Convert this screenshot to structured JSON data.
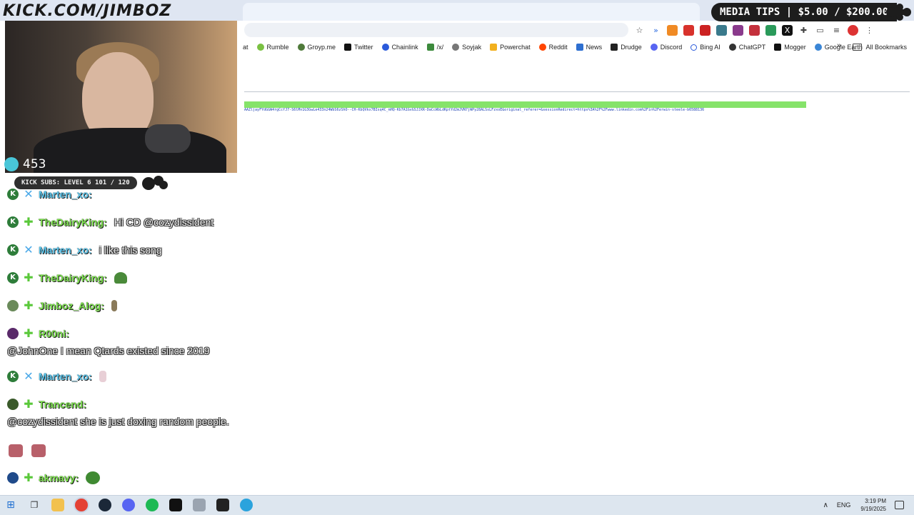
{
  "overlay": {
    "channel_url": "KICK.COM/JIMBOZ",
    "media_tips": "MEDIA TIPS | $5.00 / $200.00",
    "viewer_count": "453",
    "kick_subs": "KICK SUBS: LEVEL 6 101 / 120"
  },
  "browser": {
    "bookmarks": [
      "at",
      "Rumble",
      "Groyp.me",
      "Twitter",
      "Chainlink",
      "/x/",
      "Soyjak",
      "Powerchat",
      "Reddit",
      "News",
      "Drudge",
      "Discord",
      "Bing AI",
      "ChatGPT",
      "Mogger",
      "Google Earth"
    ],
    "all_bookmarks": "All Bookmarks",
    "page_url_text": "AAZljayFYdGGW4rgCcfJ7-S6lMn1G3GwLe433n24WbS6zShO--CH-KbQVkx7BIsq4C_mHQ-Kb7A1GvGSJJXR-DaCcWbLdKptYd2mJVN7jWPy28ALSsLFzxoE&original_referer=&sessionRedirect=https%3A%2F%2Fwww.linkedin.com%2Fin%2Ferwin-steele-b6588136"
  },
  "chat": {
    "messages": [
      {
        "user": "Marten_xo:",
        "text": ""
      },
      {
        "user": "TheDairyKing:",
        "text": "Hi CD @cozydissident"
      },
      {
        "user": "Marten_xo:",
        "text": "i like this song"
      },
      {
        "user": "TheDairyKing:",
        "text": ""
      },
      {
        "user": "Jimboz_Alog:",
        "text": ""
      },
      {
        "user": "R00ni:",
        "text": "@JohnOne I mean Qtards existed since 2019"
      },
      {
        "user": "Marten_xo:",
        "text": ""
      },
      {
        "user": "Trancend:",
        "text": "@cozydissident she is just doxing random people."
      },
      {
        "user": "akmavy:",
        "text": ""
      }
    ]
  },
  "taskbar": {
    "lang": "ENG",
    "time": "3:19 PM",
    "date": "9/19/2025"
  },
  "colors": {
    "accent_green": "#86e36a",
    "chat_user_blue": "#5cc4ea",
    "chat_user_green": "#7de04f"
  }
}
